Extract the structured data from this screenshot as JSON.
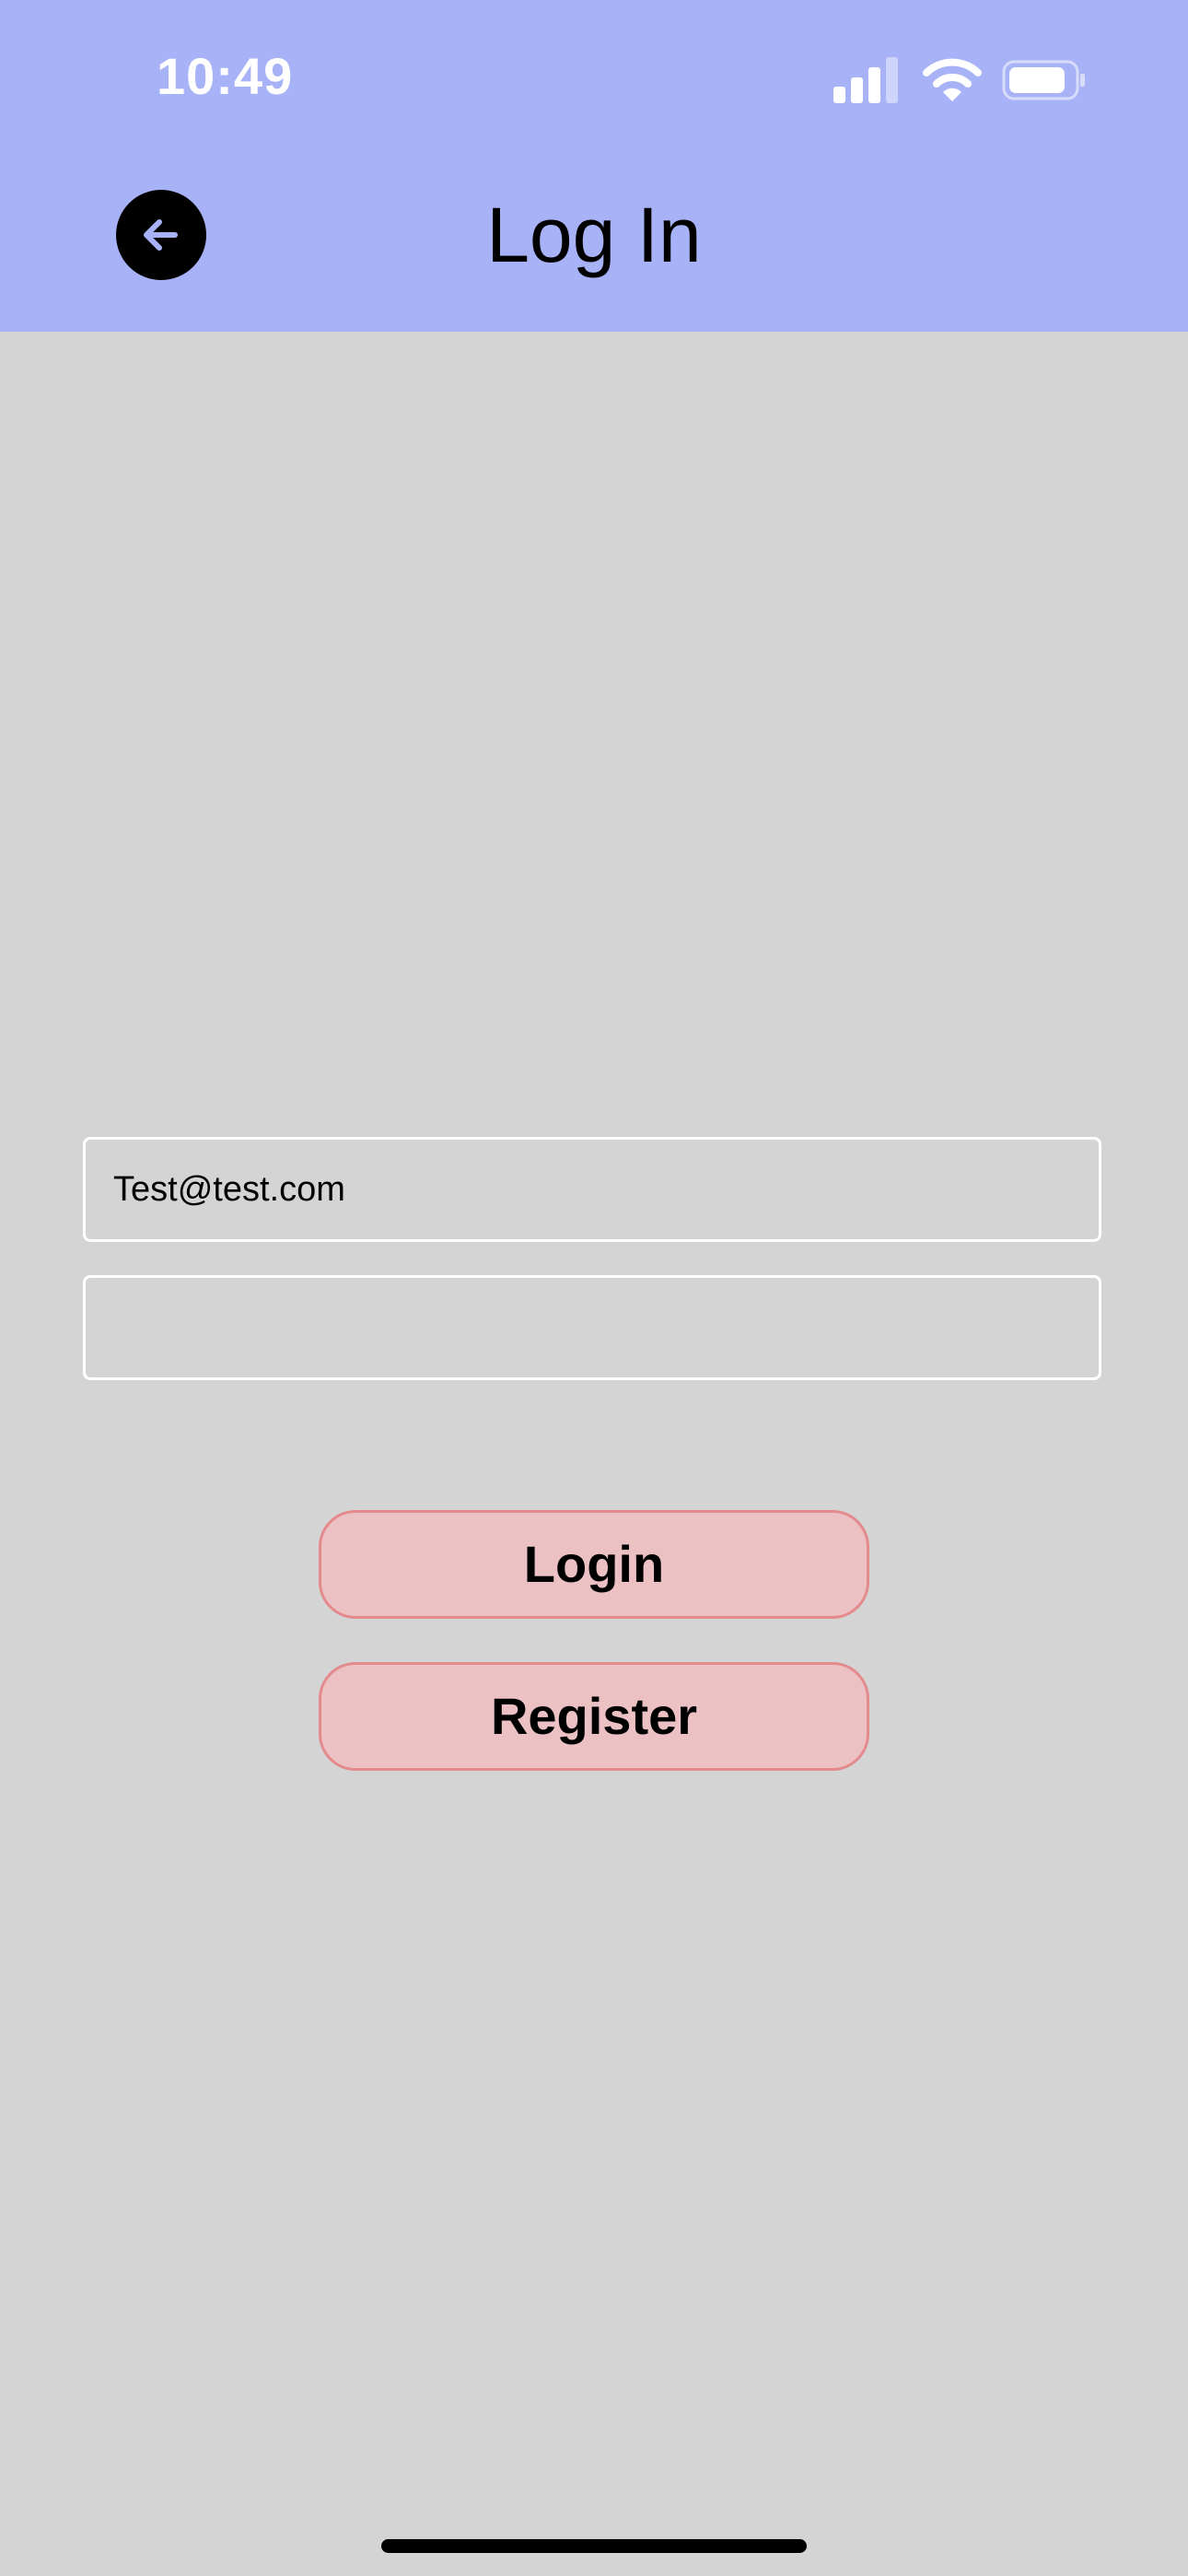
{
  "status_bar": {
    "time": "10:49",
    "icons": [
      "cell-signal-icon",
      "wifi-icon",
      "battery-icon"
    ]
  },
  "header": {
    "title": "Log In",
    "back_icon": "arrow-left-icon",
    "background_color": "#a8b2f6"
  },
  "form": {
    "email_value": "Test@test.com",
    "password_value": ""
  },
  "buttons": {
    "login_label": "Login",
    "register_label": "Register",
    "fill_color": "#ecc1c3",
    "border_color": "#e4898c"
  },
  "colors": {
    "page_background": "#d4d4d4",
    "field_border": "#ffffff"
  }
}
